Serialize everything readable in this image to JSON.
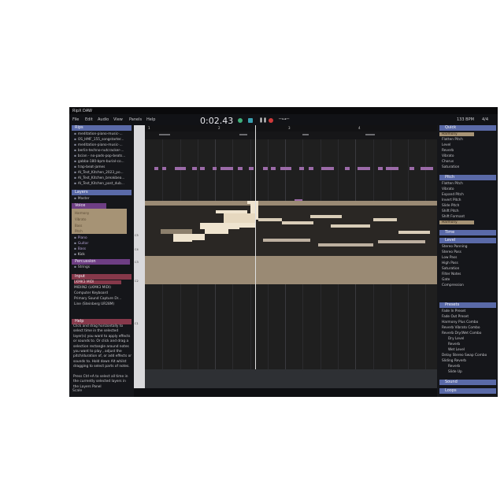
{
  "app": {
    "title": "RipX DAW"
  },
  "menu": [
    "File",
    "Edit",
    "Audio",
    "View",
    "Panels",
    "Help"
  ],
  "transport": {
    "time": "0:02.43",
    "bpm": "133 BPM",
    "signature": "4/4"
  },
  "colors": {
    "accent": "#5a6aa8",
    "purple": "#6e3e84",
    "red": "#86384a",
    "selection": "#a69375",
    "note_purple": "#9b6aa8",
    "note_cream": "#efe4cf"
  },
  "left": {
    "rips_title": "Rips",
    "rips": [
      "meditation-piano-music-...",
      "OS_HMF_155_songstarter...",
      "meditation-piano-music-...",
      "berlin-techno-nutcracker-...",
      "bcian - no-pads-pop-beats...",
      "gabba-180-bpm-burial-co...",
      "trap-beat-james",
      "AI_Test_Kitchen_2023_po...",
      "AI_Test_Kitchen_breakbea...",
      "AI_Test_Kitchen_post_dub..."
    ],
    "layers_title": "Layers",
    "layers": [
      "Master"
    ],
    "voice_title": "Voice",
    "voice_rows": [
      "Harmony",
      "Vibrato",
      "Bass",
      "Pitch"
    ],
    "instruments": [
      "Piano",
      "Guitar",
      "Bass",
      "Kick"
    ],
    "percussion_title": "Percussion",
    "percussion": [
      "Strings"
    ],
    "input_title": "Input",
    "inputs": [
      "LKMK3 MIDI",
      "MIDIIN2 (LKMK3 MIDI)",
      "Computer Keyboard",
      "Primary Sound Capture Dr...",
      "Line (Steinberg UR28M)"
    ],
    "help_title": "Help",
    "help_text": "Click and drag horizontally to select time in the selected layer(s) you want to apply effects or sounds to. Or click and drag a selection rectangle around notes you want to play , adjust the pitch/duration of, or add effects or sounds to. Hold down Alt whilst dragging to select parts of notes.\n\nPress Ctrl+A to select all time in the currently selected layers in the Layers Panel"
  },
  "piano": {
    "octaves": [
      "C5",
      "C4",
      "C3",
      "C2",
      "C1"
    ]
  },
  "editor": {
    "bars": [
      "1",
      "2",
      "3",
      "4"
    ],
    "scale_label": "Scale"
  },
  "right": {
    "quick_title": "Quick",
    "quick": [
      "Harmony",
      "Flatten Pitch",
      "Level",
      "Reverb",
      "Vibrato",
      "Chorus",
      "Saturation"
    ],
    "pitch_title": "Pitch",
    "pitch": [
      "Flatten Pitch",
      "Vibrato",
      "Expand Pitch",
      "Invert Pitch",
      "Slide Pitch",
      "Shift Pitch",
      "Shift Formant",
      "Harmony"
    ],
    "time_title": "Time",
    "level_title": "Level",
    "level": [
      "Stereo Panning",
      "Stereo Pass",
      "Low Pass",
      "High Pass",
      "Saturation",
      "Filter Notes",
      "Gate",
      "Compression"
    ],
    "presets_title": "Presets",
    "presets": [
      "Fade In Preset",
      "Fade Out Preset",
      "Harmony Plus Combo",
      "Reverb Vibrato Combo",
      "Reverb Dry/Wet Combo",
      "Dry Level",
      "Reverb",
      "Wet Level",
      "Delay Stereo Swap Combo",
      "Sliding Reverb",
      "Reverb",
      "Slide Up"
    ],
    "sound_title": "Sound",
    "loops_title": "Loops"
  }
}
